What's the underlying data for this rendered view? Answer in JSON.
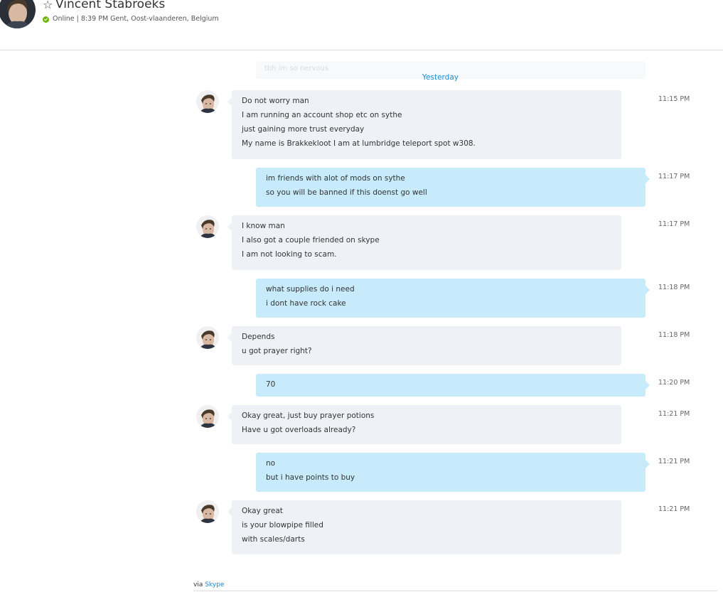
{
  "header": {
    "name": "Vincent Stabroeks",
    "status": "Online | 8:39 PM Gent, Oost-vlaanderen, Belgium",
    "favorite_icon": "star-outline-icon",
    "status_color": "#6bb700"
  },
  "ghost_text": "tbh im so nervous",
  "date_separator": "Yesterday",
  "messages": [
    {
      "direction": "in",
      "time": "11:15 PM",
      "lines": [
        "Do not worry man",
        "I am running an account shop etc on sythe",
        "just gaining more trust everyday",
        "My name is Brakkekloot I am at lumbridge teleport spot w308."
      ]
    },
    {
      "direction": "out",
      "time": "11:17 PM",
      "lines": [
        "im friends with alot of mods on sythe",
        "so you will be banned if this doenst go well"
      ]
    },
    {
      "direction": "in",
      "time": "11:17 PM",
      "lines": [
        "I know man",
        "I also got a couple friended on skype",
        "I am not looking to scam."
      ]
    },
    {
      "direction": "out",
      "time": "11:18 PM",
      "lines": [
        "what supplies do i need",
        "i dont have rock cake"
      ]
    },
    {
      "direction": "in",
      "time": "11:18 PM",
      "lines": [
        "Depends",
        "u got prayer right?"
      ]
    },
    {
      "direction": "out",
      "time": "11:20 PM",
      "lines": [
        "70"
      ]
    },
    {
      "direction": "in",
      "time": "11:21 PM",
      "lines": [
        "Okay great, just buy prayer potions",
        "Have u got overloads already?"
      ]
    },
    {
      "direction": "out",
      "time": "11:21 PM",
      "lines": [
        "no",
        "but i have points to buy"
      ]
    },
    {
      "direction": "in",
      "time": "11:21 PM",
      "lines": [
        "Okay great",
        "is your blowpipe filled",
        "with scales/darts"
      ]
    }
  ],
  "footer": {
    "via": "via",
    "link": "Skype"
  },
  "colors": {
    "accent": "#1a8ad4",
    "incoming_bubble": "#eef1f5",
    "outgoing_bubble": "#c7ebfa"
  }
}
